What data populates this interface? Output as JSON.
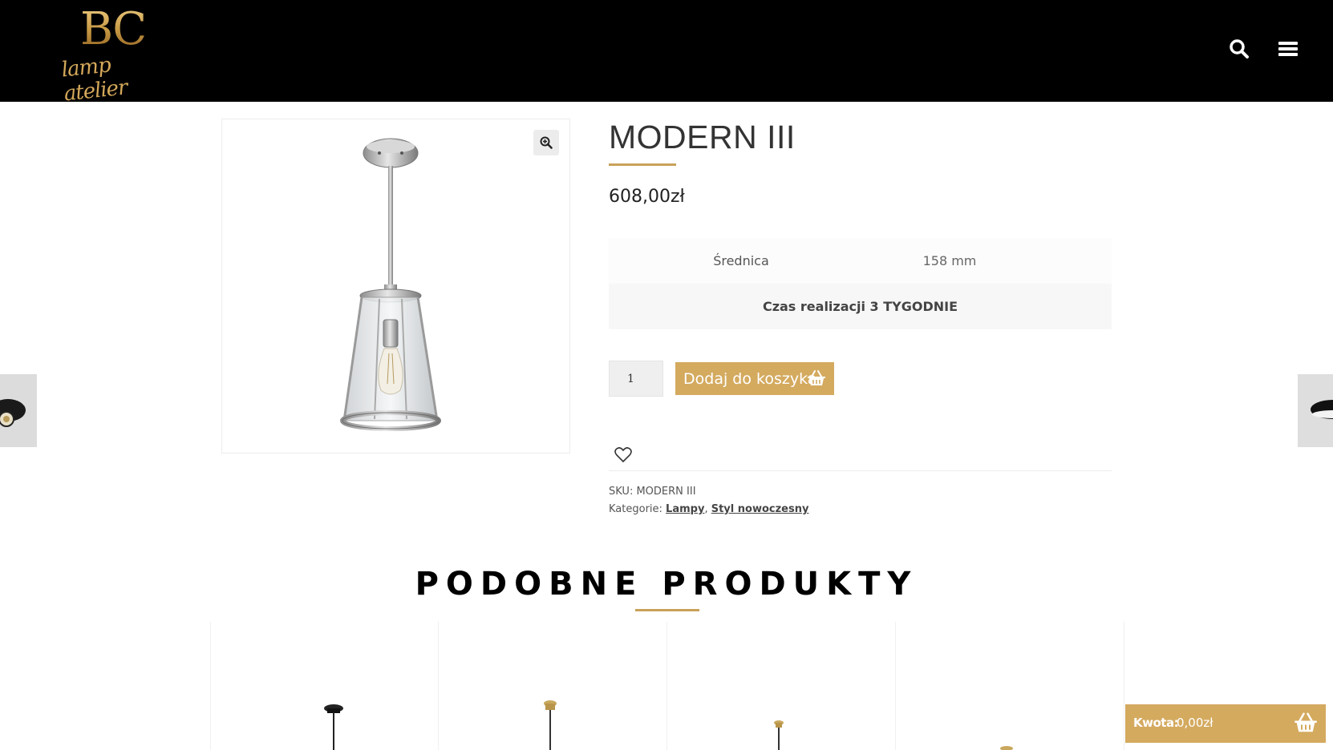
{
  "header": {
    "logo_text": "BC",
    "logo_script": "lamp atelier"
  },
  "product": {
    "title": "MODERN III",
    "price": "608,00zł",
    "attributes": [
      {
        "label": "Średnica",
        "value": "158 mm"
      }
    ],
    "lead_time": "Czas realizacji 3 TYGODNIE",
    "quantity": "1",
    "add_to_cart_label": "Dodaj do koszyka",
    "sku_label": "SKU:",
    "sku_value": "MODERN III",
    "categories_label": "Kategorie:",
    "categories": [
      "Lampy",
      "Styl nowoczesny"
    ],
    "categories_separator": ","
  },
  "related": {
    "title": "PODOBNE PRODUKTY"
  },
  "cart_widget": {
    "label": "Kwota:",
    "amount": "0,00zł"
  },
  "colors": {
    "accent": "#d4aa5f",
    "header_bg": "#000000",
    "gold_line": "#c9a15a"
  },
  "icons": {
    "search": "search-icon",
    "menu": "hamburger-menu-icon",
    "zoom": "zoom-in-icon",
    "basket": "basket-icon",
    "wishlist": "heart-icon"
  }
}
